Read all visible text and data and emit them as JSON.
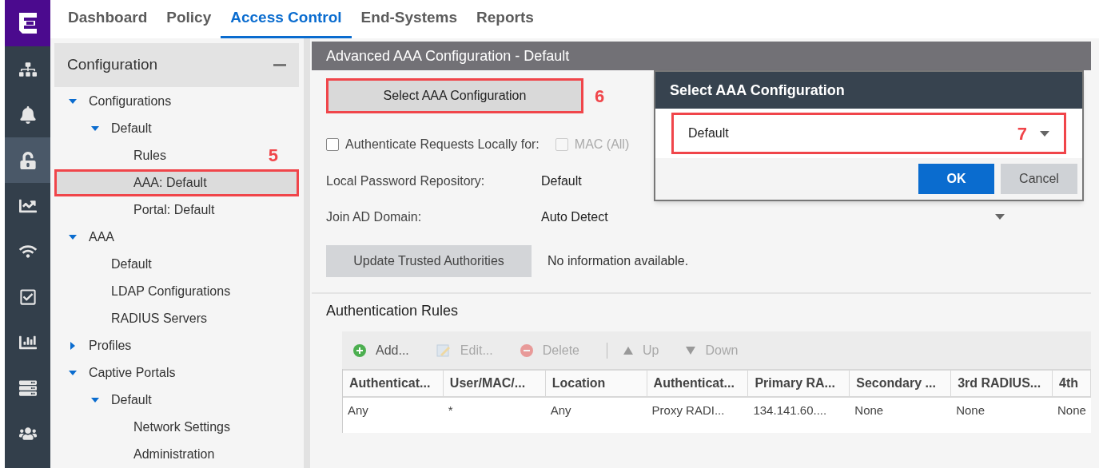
{
  "tabs": [
    {
      "label": "Dashboard",
      "selected": false
    },
    {
      "label": "Policy",
      "selected": false
    },
    {
      "label": "Access Control",
      "selected": true
    },
    {
      "label": "End-Systems",
      "selected": false
    },
    {
      "label": "Reports",
      "selected": false
    }
  ],
  "rail": [
    {
      "kind": "sitemap",
      "selected": false
    },
    {
      "kind": "bell",
      "selected": false
    },
    {
      "kind": "unlock",
      "selected": true
    },
    {
      "kind": "chart",
      "selected": false
    },
    {
      "kind": "wifi",
      "selected": false
    },
    {
      "kind": "check",
      "selected": false
    },
    {
      "kind": "bars",
      "selected": false
    },
    {
      "kind": "server",
      "selected": false
    },
    {
      "kind": "users",
      "selected": false
    }
  ],
  "sidebar": {
    "title": "Configuration",
    "tree": [
      {
        "label": "Configurations",
        "expanded": true,
        "children": [
          {
            "label": "Default",
            "expanded": true,
            "children": [
              {
                "label": "Rules",
                "selected": false
              },
              {
                "label": "AAA: Default",
                "selected": true,
                "annotation": "5"
              },
              {
                "label": "Portal: Default",
                "selected": false
              }
            ]
          }
        ]
      },
      {
        "label": "AAA",
        "expanded": true,
        "children": [
          {
            "label": "Default",
            "selected": false
          },
          {
            "label": "LDAP Configurations",
            "selected": false
          },
          {
            "label": "RADIUS Servers",
            "selected": false
          }
        ]
      },
      {
        "label": "Profiles",
        "expanded": false
      },
      {
        "label": "Captive Portals",
        "expanded": true,
        "children": [
          {
            "label": "Default",
            "expanded": true,
            "children": [
              {
                "label": "Network Settings",
                "selected": false
              },
              {
                "label": "Administration",
                "selected": false
              }
            ]
          }
        ]
      }
    ]
  },
  "panel": {
    "title": "Advanced AAA Configuration - Default",
    "select_button": {
      "label": "Select AAA Configuration",
      "annotation": "6"
    },
    "auth_locally": {
      "label": "Authenticate Requests Locally for:",
      "checked": false
    },
    "mac_all": {
      "label": "MAC (All)",
      "checked": false,
      "disabled": true
    },
    "fields": [
      {
        "label": "Local Password Repository:",
        "value": "Default",
        "kind": "text"
      },
      {
        "label": "Join AD Domain:",
        "value": "Auto Detect",
        "kind": "dropdown"
      }
    ],
    "update_button": "Update Trusted Authorities",
    "update_status": "No information available.",
    "rules": {
      "title": "Authentication Rules",
      "toolbar": [
        {
          "label": "Add...",
          "kind": "add",
          "disabled": false
        },
        {
          "label": "Edit...",
          "kind": "edit",
          "disabled": true
        },
        {
          "label": "Delete",
          "kind": "delete",
          "disabled": true
        },
        {
          "label": "Up",
          "kind": "up",
          "disabled": true
        },
        {
          "label": "Down",
          "kind": "down",
          "disabled": true
        }
      ],
      "columns": [
        "Authenticat...",
        "User/MAC/...",
        "Location",
        "Authenticat...",
        "Primary RA...",
        "Secondary ...",
        "3rd RADIUS...",
        "4th"
      ],
      "rows": [
        [
          "Any",
          "*",
          "Any",
          "Proxy RADI...",
          "134.141.60....",
          "None",
          "None",
          "None"
        ]
      ]
    }
  },
  "dialog": {
    "title": "Select AAA Configuration",
    "value": "Default",
    "annotation": "7",
    "buttons": [
      {
        "label": "OK",
        "kind": "primary"
      },
      {
        "label": "Cancel",
        "kind": "secondary"
      }
    ]
  }
}
